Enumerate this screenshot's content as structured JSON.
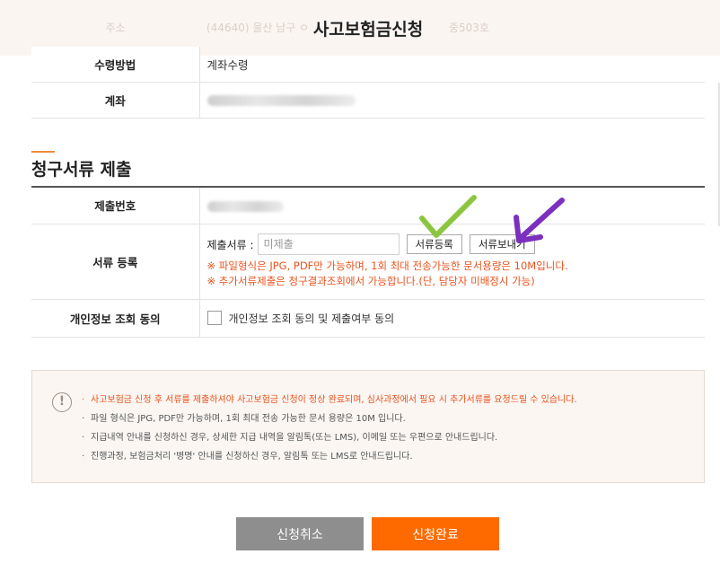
{
  "header": {
    "title": "사고보험금신청",
    "behind_label": "주소",
    "behind_value": "(44640) 울산 남구 ㅇ",
    "behind_value2": "중503호"
  },
  "claim_info": {
    "payment_method_label": "수령방법",
    "payment_method_value": "계좌수령",
    "account_label": "계좌"
  },
  "section": {
    "title": "청구서류 제출"
  },
  "submission": {
    "number_label": "제출번호",
    "doc_label": "서류 등록",
    "doc_field_label": "제출서류 :",
    "doc_input_placeholder": "미제출",
    "register_button": "서류등록",
    "send_button": "서류보내기",
    "warn_1": "※ 파일형식은 JPG, PDF만 가능하며, 1회 최대 전송가능한 문서용량은 10M입니다.",
    "warn_2": "※ 추가서류제출은 청구결과조회에서 가능합니다.(단, 담당자 미배정시 가능)",
    "consent_label": "개인정보 조회 동의",
    "consent_checkbox_label": "개인정보 조회 동의 및 제출여부 동의"
  },
  "notice": {
    "items": [
      "사고보험금 신청 후 서류를 제출하셔야 사고보험금 신청이 정상 완료되며, 심사과정에서 필요 시 추가서류를 요청드릴 수 있습니다.",
      "파일 형식은 JPG, PDF만 가능하며, 1회 최대 전송 가능한 문서 용량은 10M 입니다.",
      "지급내역 안내를 신청하신 경우, 상세한 지급 내역을 알림톡(또는 LMS), 이메일 또는 우편으로 안내드립니다.",
      "진행과정, 보험금처리 '병명' 안내를 신청하신 경우, 알림톡 또는 LMS로 안내드립니다."
    ]
  },
  "buttons": {
    "cancel": "신청취소",
    "submit": "신청완료"
  },
  "colors": {
    "accent": "#ff6a00",
    "warning_text": "#e8531f",
    "cancel_button": "#8e8e8e",
    "annotation_check": "#8cc63f",
    "annotation_arrow": "#7b2fbe"
  }
}
